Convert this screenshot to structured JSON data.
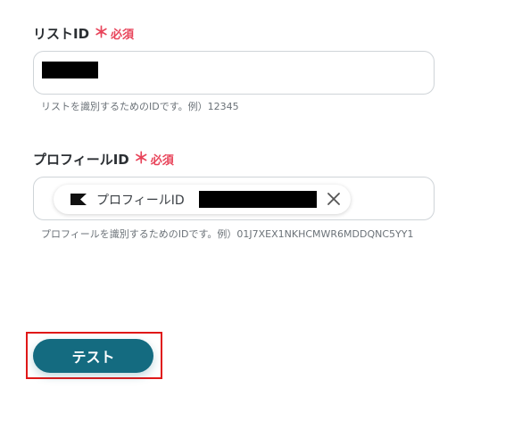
{
  "list_id_field": {
    "label": "リストID",
    "required_mark": "＊",
    "required_text": "必須",
    "value": "",
    "helper": "リストを識別するためのIDです。例）12345"
  },
  "profile_id_field": {
    "label": "プロフィールID",
    "required_mark": "＊",
    "required_text": "必須",
    "chip_label": "プロフィールID",
    "chip_value": "",
    "helper": "プロフィールを識別するためのIDです。例）01J7XEX1NKHCMWR6MDDQNC5YY1"
  },
  "actions": {
    "test_label": "テスト"
  },
  "colors": {
    "required": "#e8445a",
    "button": "#146b80",
    "highlight": "#e01818"
  }
}
